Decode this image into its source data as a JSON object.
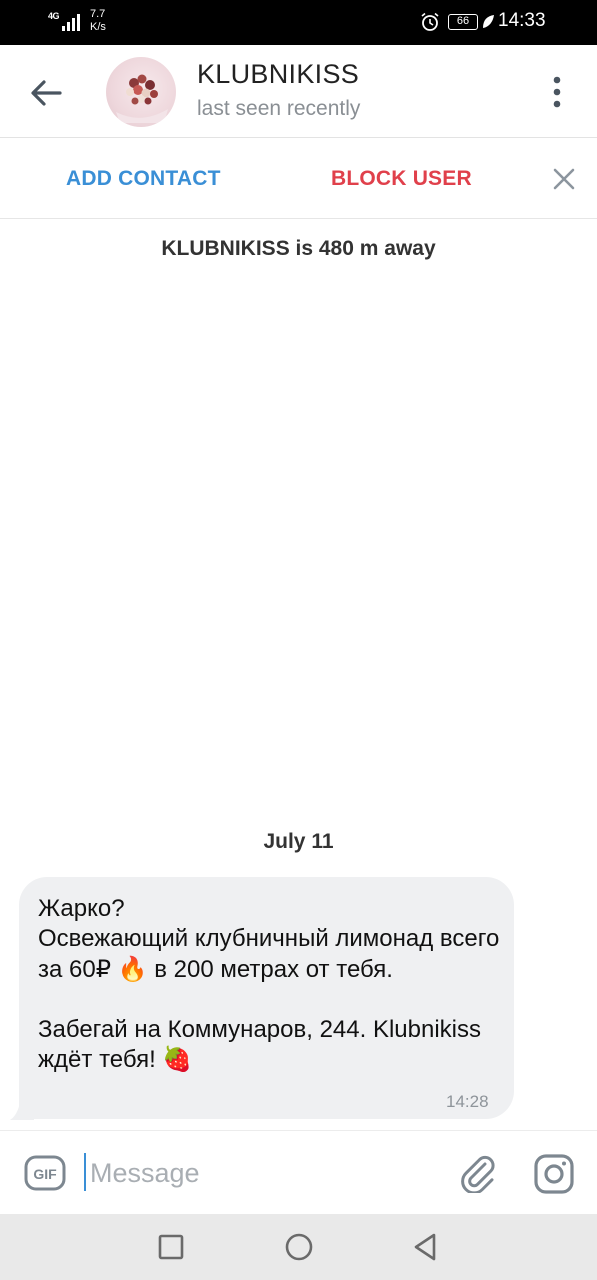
{
  "status_bar": {
    "network": "4G",
    "speed_value": "7.7",
    "speed_unit": "K/s",
    "battery": "66",
    "time": "14:33"
  },
  "header": {
    "title": "KLUBNIKISS",
    "subtitle": "last seen recently",
    "back_icon": "arrow-left-icon",
    "menu_icon": "more-vert-icon"
  },
  "action_bar": {
    "add_contact_label": "ADD CONTACT",
    "block_user_label": "BLOCK USER",
    "close_icon": "close-icon"
  },
  "chat": {
    "distance_notice": "KLUBNIKISS is 480 m away",
    "date_label": "July 11",
    "messages": [
      {
        "text": "Жарко?\nОсвежающий клубничный лимонад всего за 60₽ 🔥 в 200 метрах от тебя.\n\nЗабегай на Коммунаров, 244. Klubnikiss ждёт тебя! 🍓",
        "time": "14:28",
        "direction": "incoming"
      }
    ]
  },
  "input_bar": {
    "placeholder": "Message",
    "value": "",
    "gif_label": "GIF"
  },
  "colors": {
    "accent": "#3a8fd6",
    "danger": "#e0404b",
    "bubble": "#eff0f2",
    "muted": "#8a8f94"
  }
}
